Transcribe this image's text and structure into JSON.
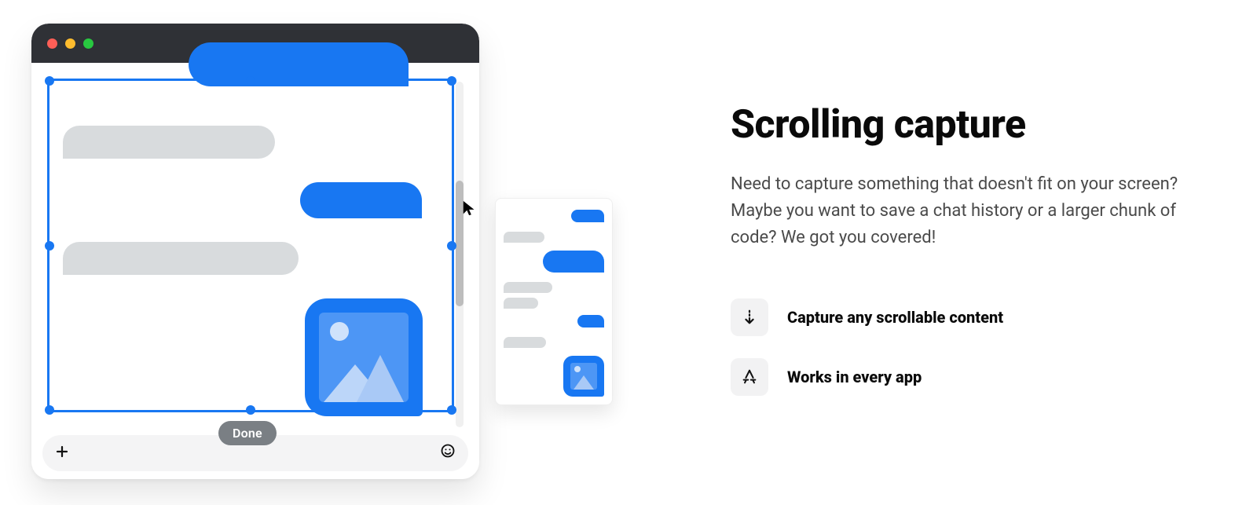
{
  "headline": "Scrolling capture",
  "body": "Need to capture something that doesn't fit on your screen? Maybe you want to save a chat history or a larger chunk of code? We got you covered!",
  "features": [
    {
      "icon": "arrow-down-dashed-icon",
      "label": "Capture any scrollable content"
    },
    {
      "icon": "app-store-icon",
      "label": "Works in every app"
    }
  ],
  "capture_button_label": "Done",
  "colors": {
    "accent": "#1877f2",
    "grey_bubble": "#d8dbdd",
    "titlebar": "#2f3136"
  }
}
